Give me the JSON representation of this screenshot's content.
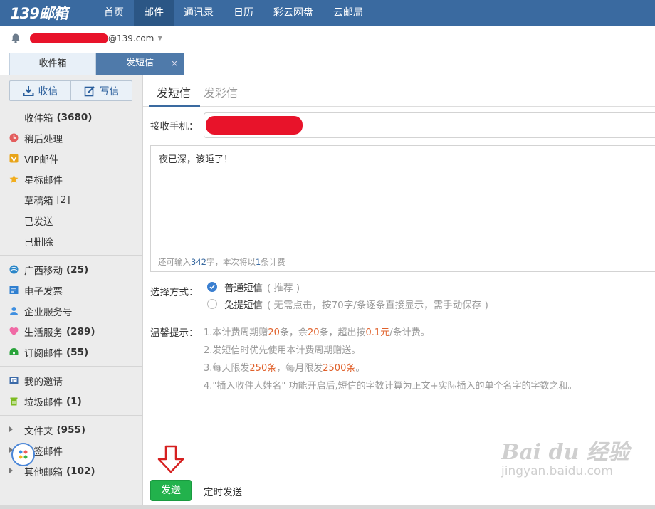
{
  "brand": {
    "logo": "139邮箱"
  },
  "nav": [
    "首页",
    "邮件",
    "通讯录",
    "日历",
    "彩云网盘",
    "云邮局"
  ],
  "account": {
    "domain": "@139.com"
  },
  "tabs": {
    "inbox": "收件箱",
    "sms": "发短信",
    "close": "×"
  },
  "sidebar": {
    "receive": "收信",
    "write": "写信",
    "items": [
      {
        "label": "收件箱",
        "count": "(3680)"
      },
      {
        "label": "稍后处理"
      },
      {
        "label": "VIP邮件"
      },
      {
        "label": "星标邮件"
      },
      {
        "label": "草稿箱",
        "count": "[2]"
      },
      {
        "label": "已发送"
      },
      {
        "label": "已删除"
      }
    ],
    "items2": [
      {
        "label": "广西移动",
        "count": "(25)"
      },
      {
        "label": "电子发票"
      },
      {
        "label": "企业服务号"
      },
      {
        "label": "生活服务",
        "count": "(289)"
      },
      {
        "label": "订阅邮件",
        "count": "(55)"
      }
    ],
    "items3": [
      {
        "label": "我的邀请"
      },
      {
        "label": "垃圾邮件",
        "count": "(1)"
      }
    ],
    "items4": [
      {
        "label": "文件夹",
        "count": "(955)"
      },
      {
        "label": "标签邮件"
      },
      {
        "label": "其他邮箱",
        "count": "(102)"
      }
    ]
  },
  "compose": {
    "tab_sms": "发短信",
    "tab_mms": "发彩信",
    "recipient_label": "接收手机：",
    "message": "夜已深，该睡了！",
    "counter": {
      "prefix": "还可输入",
      "remaining": "342",
      "middle": "字，本次将以",
      "msgs": "1",
      "suffix": "条计费"
    },
    "method_label": "选择方式：",
    "method_normal": "普通短信",
    "method_normal_note": "( 推荐 )",
    "method_free": "免提短信",
    "method_free_note": "( 无需点击，按70字/条逐条直接显示，需手动保存 )",
    "tips_label": "温馨提示：",
    "tip1": {
      "a": "1.本计费周期赠",
      "b": "20",
      "c": "条，余",
      "d": "20",
      "e": "条，超出按",
      "f": "0.1元",
      "g": "/条计费。"
    },
    "tip2": "2.发短信时优先使用本计费周期赠送。",
    "tip3": {
      "a": "3.每天限发",
      "b": "250条",
      "c": "，每月限发",
      "d": "2500条",
      "e": "。"
    },
    "tip4": "4.\"插入收件人姓名\" 功能开启后,短信的字数计算为正文+实际插入的单个名字的字数之和。",
    "send": "发送",
    "schedule": "定时发送"
  },
  "watermark": {
    "main": "Bai du 经验",
    "sub": "jingyan.baidu.com"
  },
  "colors": {
    "nav": "#3a6aa0",
    "send": "#22b24c",
    "highlight": "#e0602a",
    "redaction": "#e8132a"
  }
}
